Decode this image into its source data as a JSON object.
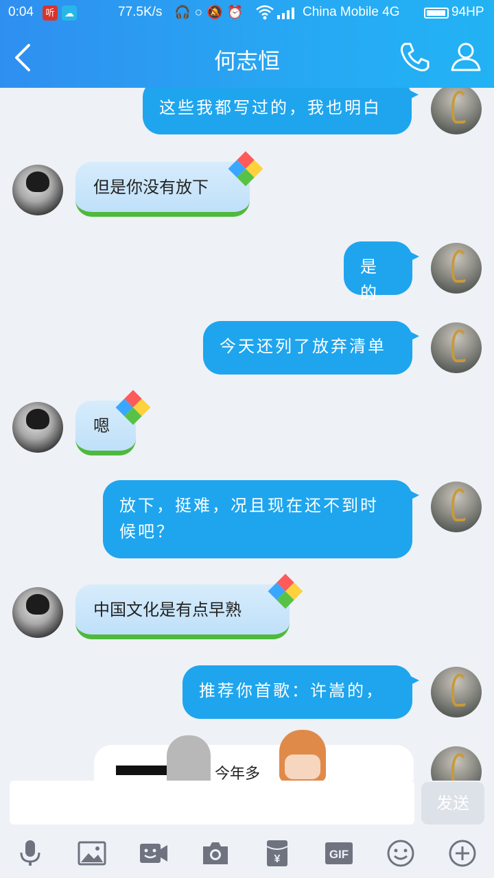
{
  "status_bar": {
    "time": "0:04",
    "badge_1": "听",
    "badge_2": "☁",
    "net_speed": "77.5K/s",
    "icons": "🎧○🔕⏰",
    "carrier": "China Mobile 4G",
    "battery": "94HP"
  },
  "header": {
    "title": "何志恒",
    "back_icon": "chevron-left-icon",
    "call_icon": "phone-icon",
    "profile_icon": "person-icon"
  },
  "messages": [
    {
      "side": "out",
      "text": "这些我都写过的，我也明白"
    },
    {
      "side": "in",
      "text": "但是你没有放下"
    },
    {
      "side": "out",
      "text": "是的"
    },
    {
      "side": "out",
      "text": "今天还列了放弃清单"
    },
    {
      "side": "in",
      "text": "嗯"
    },
    {
      "side": "out",
      "text": "放下，挺难，况且现在还不到时候吧？"
    },
    {
      "side": "in",
      "text": "中国文化是有点早熟"
    },
    {
      "side": "out",
      "text": "推荐你首歌：许嵩的，"
    }
  ],
  "card": {
    "text": "今年多"
  },
  "input": {
    "value": "",
    "send_label": "发送"
  },
  "toolbar": {
    "items": [
      "mic-icon",
      "image-icon",
      "video-icon",
      "camera-icon",
      "red-packet-icon",
      "gif-icon",
      "emoji-icon",
      "plus-icon"
    ],
    "gif_label": "GIF",
    "yen_label": "¥"
  },
  "colors": {
    "header_start": "#2f8ff0",
    "header_end": "#22b3f4",
    "out_bubble": "#1ea5ee",
    "in_bubble": "#c9e6fb",
    "in_bubble_grass": "#4fb93b",
    "background": "#eef1f6"
  }
}
